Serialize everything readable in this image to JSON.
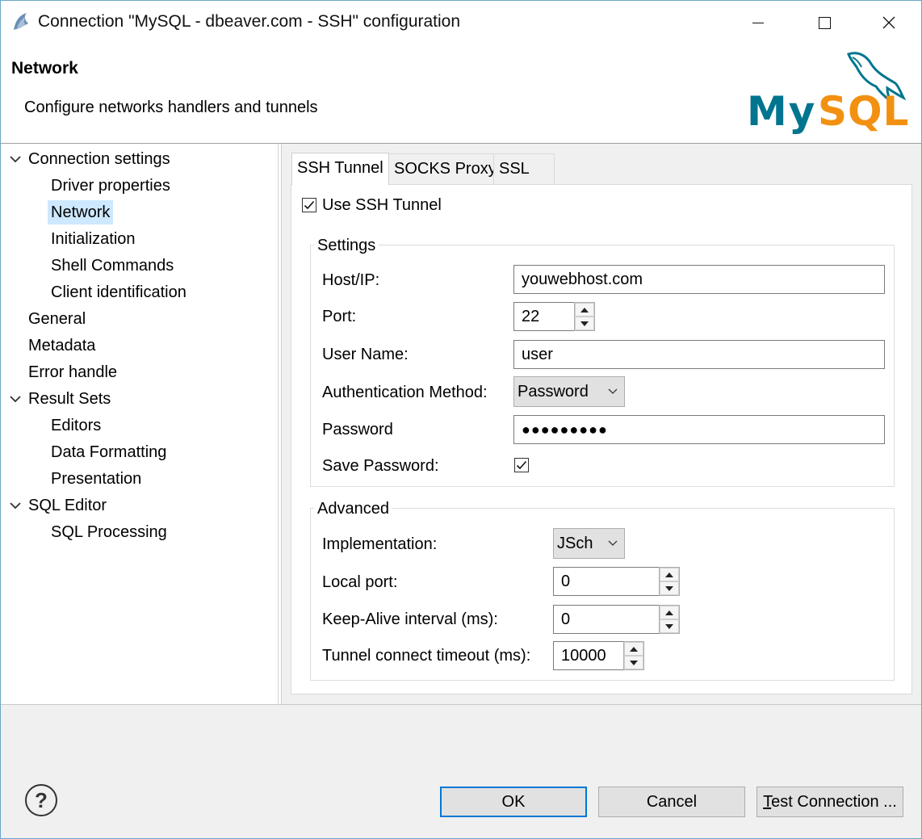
{
  "window": {
    "title": "Connection \"MySQL - dbeaver.com - SSH\" configuration"
  },
  "header": {
    "title": "Network",
    "description": "Configure networks handlers and tunnels"
  },
  "logo": {
    "text": "MySQL",
    "color_primary": "#00758f",
    "color_secondary": "#f29111"
  },
  "tree": {
    "items": [
      {
        "label": "Connection settings",
        "level": 0,
        "expanded": true
      },
      {
        "label": "Driver properties",
        "level": 1
      },
      {
        "label": "Network",
        "level": 1,
        "selected": true
      },
      {
        "label": "Initialization",
        "level": 1
      },
      {
        "label": "Shell Commands",
        "level": 1
      },
      {
        "label": "Client identification",
        "level": 1
      },
      {
        "label": "General",
        "level": 0
      },
      {
        "label": "Metadata",
        "level": 0
      },
      {
        "label": "Error handle",
        "level": 0
      },
      {
        "label": "Result Sets",
        "level": 0,
        "expanded": true
      },
      {
        "label": "Editors",
        "level": 1
      },
      {
        "label": "Data Formatting",
        "level": 1
      },
      {
        "label": "Presentation",
        "level": 1
      },
      {
        "label": "SQL Editor",
        "level": 0,
        "expanded": true
      },
      {
        "label": "SQL Processing",
        "level": 1
      }
    ]
  },
  "tabs": [
    {
      "label": "SSH Tunnel",
      "active": true
    },
    {
      "label": "SOCKS Proxy"
    },
    {
      "label": "SSL"
    }
  ],
  "ssh": {
    "use_tunnel_label": "Use SSH Tunnel",
    "use_tunnel_checked": true,
    "settings": {
      "group_title": "Settings",
      "host_label": "Host/IP:",
      "host_value": "youwebhost.com",
      "port_label": "Port:",
      "port_value": "22",
      "user_label": "User Name:",
      "user_value": "user",
      "auth_label": "Authentication Method:",
      "auth_value": "Password",
      "password_label": "Password",
      "password_value": "●●●●●●●●●",
      "save_password_label": "Save Password:",
      "save_password_checked": true
    },
    "advanced": {
      "group_title": "Advanced",
      "impl_label": "Implementation:",
      "impl_value": "JSch",
      "local_port_label": "Local port:",
      "local_port_value": "0",
      "keepalive_label": "Keep-Alive interval (ms):",
      "keepalive_value": "0",
      "timeout_label": "Tunnel connect timeout (ms):",
      "timeout_value": "10000"
    }
  },
  "footer": {
    "help_label": "?",
    "ok_label": "OK",
    "cancel_label": "Cancel",
    "test_mnemonic": "T",
    "test_rest": "est Connection ..."
  }
}
